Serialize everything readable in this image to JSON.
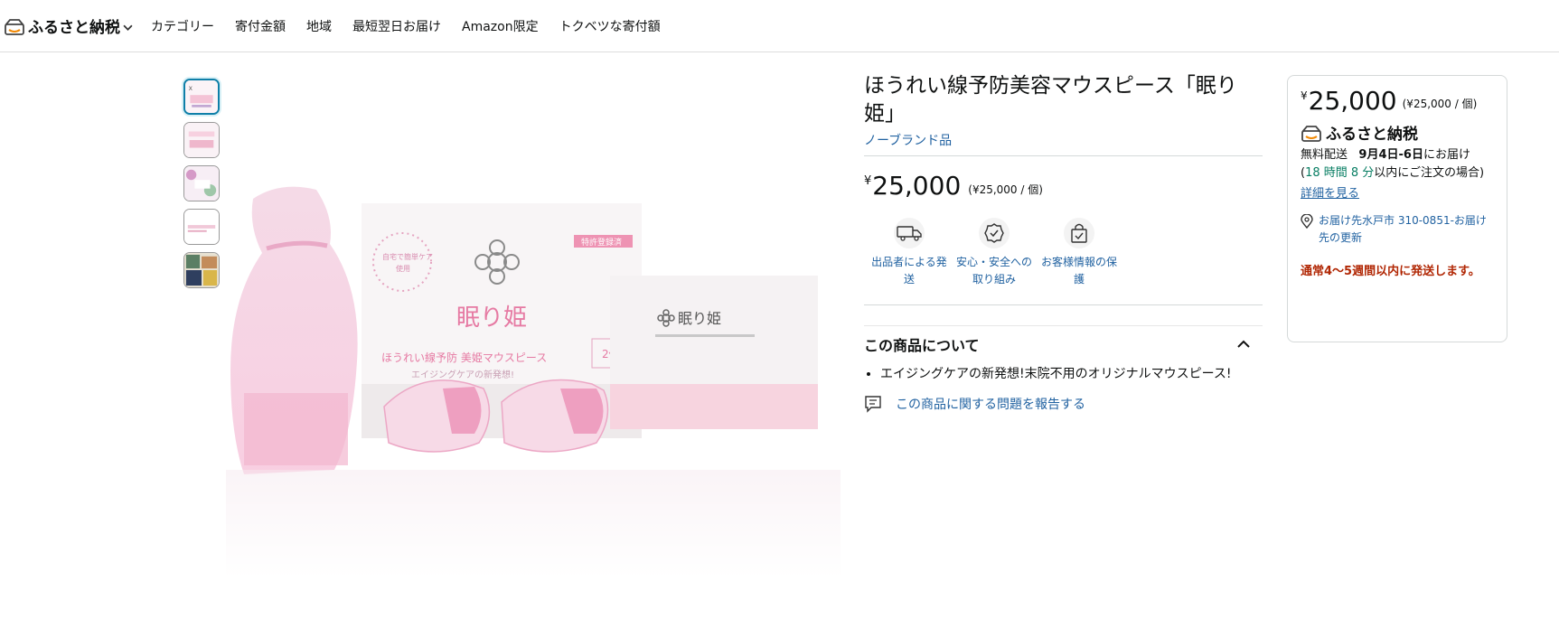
{
  "nav": {
    "brand": "ふるさと納税",
    "links": [
      "カテゴリー",
      "寄付金額",
      "地域",
      "最短翌日お届け",
      "Amazon限定",
      "トクベツな寄付額"
    ]
  },
  "product": {
    "title": "ほうれい線予防美容マウスピース「眠り姫」",
    "brand_link": "ノーブランド品",
    "price_symbol": "¥",
    "price": "25,000",
    "unit_price": "(¥25,000 / 個)",
    "image_text": {
      "box_brand": "眠り姫",
      "box_subtitle": "ほうれい線予防 美姫マウスピース",
      "box_tagline": "エイジングケアの新発想!",
      "box_badge": "2個",
      "side_brand": "眠り姫",
      "red_tag": "特許登録済",
      "circle_text": "自宅で簡単ケア",
      "circle_sub": "使用"
    },
    "features": [
      {
        "icon": "truck-icon",
        "label": "出品者による発送"
      },
      {
        "icon": "shield-badge-icon",
        "label": "安心・安全への取り組み"
      },
      {
        "icon": "lock-bag-icon",
        "label": "お客様情報の保護"
      }
    ],
    "about_title": "この商品について",
    "bullets": [
      "エイジングケアの新発想!末院不用のオリジナルマウスピース!"
    ],
    "report_label": "この商品に関する問題を報告する"
  },
  "buybox": {
    "price_symbol": "¥",
    "price": "25,000",
    "unit_price": "(¥25,000 / 個)",
    "brand": "ふるさと納税",
    "delivery_prefix": "無料配送",
    "delivery_date": "9月4日-6日",
    "delivery_suffix": "にお届け",
    "countdown_prefix": "(",
    "countdown": "18 時間 8 分",
    "countdown_suffix": "以内にご注文の場合)",
    "detail_link": "詳細を見る",
    "location": "お届け先水戸市 310-0851-お届け先の更新",
    "ship_note": "通常4～5週間以内に発送します。"
  },
  "colors": {
    "link": "#2162a1",
    "deal_red": "#b12704",
    "countdown_green": "#067d62",
    "thumb_active": "#0f7fa8",
    "pink": "#e89ab8"
  }
}
